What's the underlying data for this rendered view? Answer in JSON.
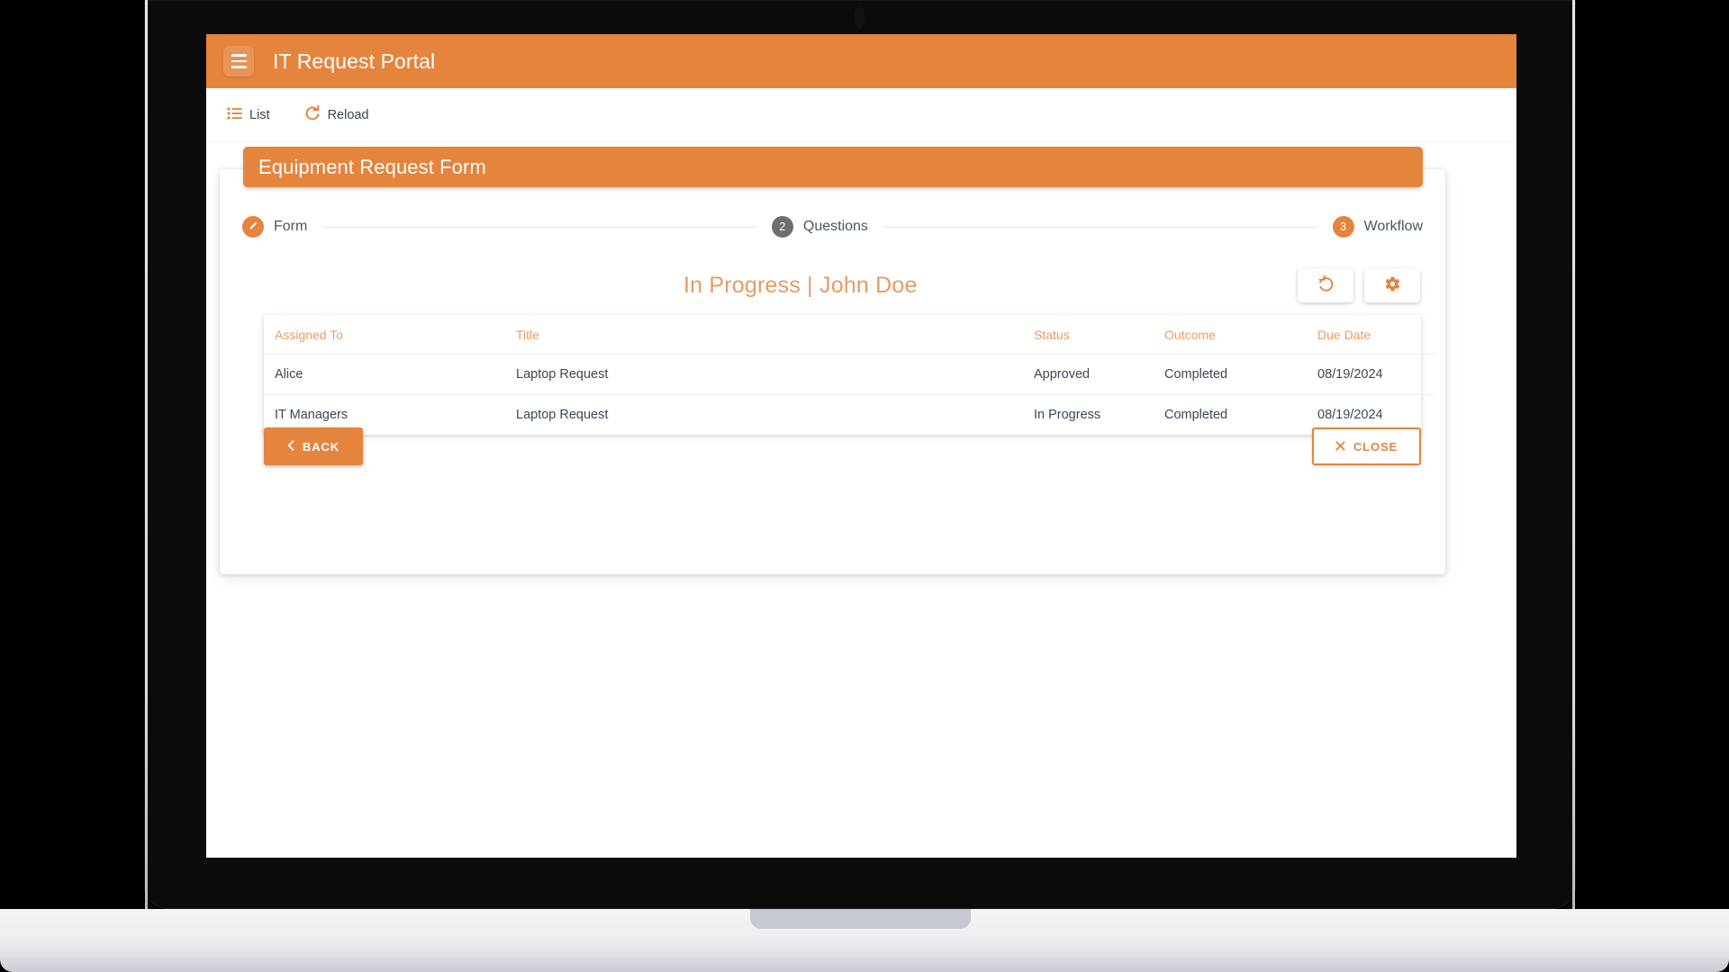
{
  "app": {
    "title": "IT Request Portal",
    "menu_icon": "hamburger-icon"
  },
  "colors": {
    "accent": "#e5843d",
    "accent_light": "#eb9b62",
    "heading": "#e69a62",
    "text": "#3d4753",
    "step_inactive": "#6e6e6e"
  },
  "toolbar": {
    "items": [
      {
        "label": "List",
        "icon": "list-icon"
      },
      {
        "label": "Reload",
        "icon": "reload-icon"
      }
    ]
  },
  "banner": {
    "title": "Equipment Request Form"
  },
  "stepper": {
    "steps": [
      {
        "number": "1",
        "label": "Form",
        "state": "active",
        "icon": "pencil-icon"
      },
      {
        "number": "2",
        "label": "Questions",
        "state": "inactive",
        "icon": ""
      },
      {
        "number": "3",
        "label": "Workflow",
        "state": "active",
        "icon": ""
      }
    ]
  },
  "status": {
    "heading": "In Progress  |  John Doe",
    "actions": [
      {
        "name": "refresh",
        "icon": "refresh-icon"
      },
      {
        "name": "settings",
        "icon": "gear-icon"
      }
    ]
  },
  "table": {
    "columns": [
      "Assigned To",
      "Title",
      "Status",
      "Outcome",
      "Due Date"
    ],
    "rows": [
      {
        "assigned_to": "Alice",
        "title": "Laptop Request",
        "status": "Approved",
        "outcome": "Completed",
        "due_date": "08/19/2024"
      },
      {
        "assigned_to": "IT Managers",
        "title": "Laptop Request",
        "status": "In Progress",
        "outcome": "Completed",
        "due_date": "08/19/2024"
      }
    ]
  },
  "footer": {
    "back_label": "BACK",
    "close_label": "CLOSE"
  }
}
